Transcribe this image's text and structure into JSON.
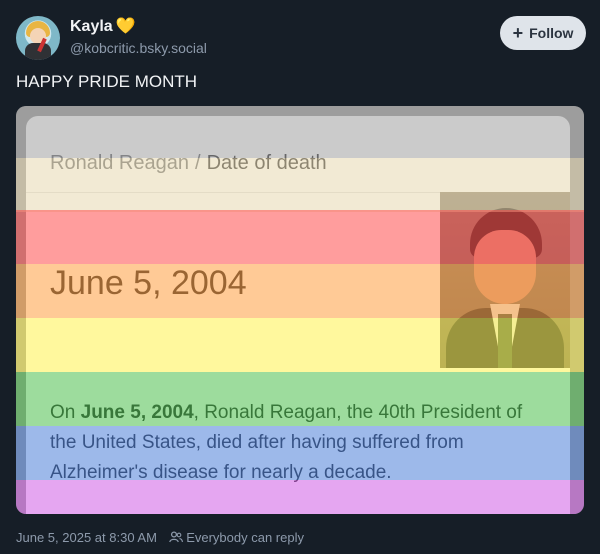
{
  "author": {
    "display_name": "Kayla",
    "badge_emoji": "💛",
    "handle": "@kobcritic.bsky.social",
    "avatar_icon": "avatar-icon"
  },
  "follow_button": {
    "label": "Follow",
    "icon": "plus-icon"
  },
  "post": {
    "text": "HAPPY PRIDE MONTH"
  },
  "embed": {
    "breadcrumb_parent": "Ronald Reagan",
    "breadcrumb_separator": "/",
    "breadcrumb_current": "Date of death",
    "date_big": "June 5, 2004",
    "description_prefix": "On ",
    "description_bold": "June 5, 2004",
    "description_rest": ", Ronald Reagan, the 40th President of the United States, died after having suffered from Alzheimer's disease for nearly a decade.",
    "overlay_colors": [
      "#a0a0a0",
      "#e8d9b0",
      "#ff4d4d",
      "#ff9f40",
      "#fff24d",
      "#4dbf4d",
      "#4d7fd9",
      "#cf5ce6"
    ]
  },
  "footer": {
    "timestamp": "June 5, 2025 at 8:30 AM",
    "reply_setting": "Everybody can reply",
    "reply_icon": "people-icon"
  }
}
